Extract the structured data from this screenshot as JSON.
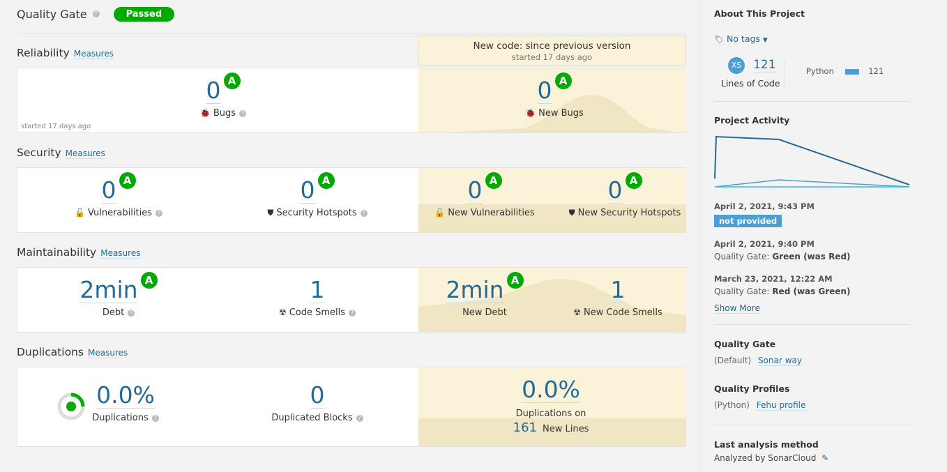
{
  "quality_gate": {
    "title": "Quality Gate",
    "status": "Passed"
  },
  "new_code": {
    "title": "New code: since previous version",
    "started": "started 17 days ago"
  },
  "measures_label": "Measures",
  "reliability": {
    "title": "Reliability",
    "bugs": {
      "value": "0",
      "rating": "A",
      "label": "Bugs"
    },
    "started": "started 17 days ago",
    "new_bugs": {
      "value": "0",
      "rating": "A",
      "label": "New Bugs"
    }
  },
  "security": {
    "title": "Security",
    "vulnerabilities": {
      "value": "0",
      "rating": "A",
      "label": "Vulnerabilities"
    },
    "hotspots": {
      "value": "0",
      "rating": "A",
      "label": "Security Hotspots"
    },
    "new_vulnerabilities": {
      "value": "0",
      "rating": "A",
      "label": "New Vulnerabilities"
    },
    "new_hotspots": {
      "value": "0",
      "rating": "A",
      "label": "New Security Hotspots"
    }
  },
  "maintainability": {
    "title": "Maintainability",
    "debt": {
      "value": "2min",
      "rating": "A",
      "label": "Debt"
    },
    "code_smells": {
      "value": "1",
      "label": "Code Smells"
    },
    "new_debt": {
      "value": "2min",
      "rating": "A",
      "label": "New Debt"
    },
    "new_code_smells": {
      "value": "1",
      "label": "New Code Smells"
    }
  },
  "duplications": {
    "title": "Duplications",
    "duplications": {
      "value": "0.0%",
      "label": "Duplications"
    },
    "blocks": {
      "value": "0",
      "label": "Duplicated Blocks"
    },
    "new_duplications": {
      "value": "0.0%",
      "label": "Duplications on",
      "lines_value": "161",
      "lines_label": "New Lines"
    }
  },
  "sidebar": {
    "about_title": "About This Project",
    "tags": "No tags",
    "size_badge": "XS",
    "loc_value": "121",
    "loc_label": "Lines of Code",
    "language": "Python",
    "language_loc": "121",
    "activity_title": "Project Activity",
    "activities": [
      {
        "date": "April 2, 2021, 9:43 PM",
        "badge": "not provided"
      },
      {
        "date": "April 2, 2021, 9:40 PM",
        "prefix": "Quality Gate:",
        "text": "Green (was Red)"
      },
      {
        "date": "March 23, 2021, 12:22 AM",
        "prefix": "Quality Gate:",
        "text": "Red (was Green)"
      }
    ],
    "show_more": "Show More",
    "qg_title": "Quality Gate",
    "qg_prefix": "(Default)",
    "qg_link": "Sonar way",
    "qp_title": "Quality Profiles",
    "qp_prefix": "(Python)",
    "qp_link": "Fehu profile",
    "analysis_title": "Last analysis method",
    "analysis_text": "Analyzed by SonarCloud"
  },
  "colors": {
    "link": "#236a97",
    "passed": "#00aa00",
    "new_code_bg": "#faf3d9",
    "badge": "#4b9fd5"
  }
}
